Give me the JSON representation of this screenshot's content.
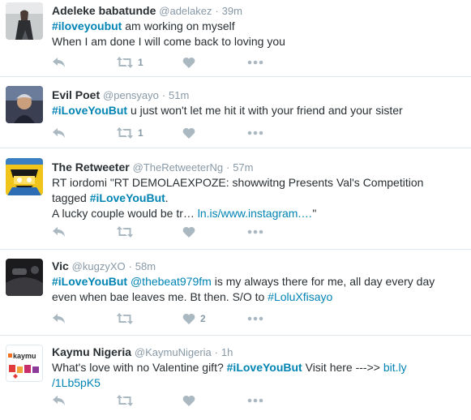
{
  "tweets": [
    {
      "name": "Adeleke babatunde",
      "handle": "@adelakez",
      "time": "39m",
      "tag": "#iloveyoubut",
      "text_after_tag": " am working  on  myself",
      "line2": "When I  am  done I will come back to  loving  you",
      "retweet_count": "1",
      "like_count": ""
    },
    {
      "name": "Evil Poet",
      "handle": "@pensyayo",
      "time": "51m",
      "tag": "#iLoveYouBut",
      "text_after_tag": " u just won't let me hit it with your friend and your sister",
      "retweet_count": "1",
      "like_count": ""
    },
    {
      "name": "The Retweeter",
      "handle": "@TheRetweeterNg",
      "time": "57m",
      "line1": "RT iordomi \"RT DEMOLAEXPOZE: showwitng Presents Val's Competition",
      "line2_before": "tagged ",
      "tag": "#iLoveYouBut",
      "line2_after": ".",
      "line3_before": "A lucky couple would be tr…  ",
      "link": "ln.is/www.instagram.…",
      "line3_after": "\"",
      "retweet_count": "",
      "like_count": ""
    },
    {
      "name": "Vic",
      "handle": "@kugzyXO",
      "time": "58m",
      "tag": "#iLoveYouBut",
      "mention": "@thebeat979fm",
      "text_after_mention": " is my always there for me, all day every day",
      "line2_before": "even when bae leaves me. Bt then. S/O to ",
      "tag2": "#LoluXfisayo",
      "retweet_count": "",
      "like_count": "2"
    },
    {
      "name": "Kaymu Nigeria",
      "handle": "@KaymuNigeria",
      "time": "1h",
      "line1_before": "What's love with no Valentine gift? ",
      "tag": "#iLoveYouBut",
      "line1_mid": " Visit here --->> ",
      "link1": "bit.ly",
      "link2": "/1Lb5pK5",
      "avatar_text": "kaymu",
      "retweet_count": "",
      "like_count": ""
    }
  ],
  "colors": {
    "link": "#0084b4",
    "muted": "#8899a6",
    "text": "#292f33",
    "divider": "#e1e8ed"
  },
  "icons": [
    "reply-icon",
    "retweet-icon",
    "heart-icon",
    "more-icon"
  ]
}
